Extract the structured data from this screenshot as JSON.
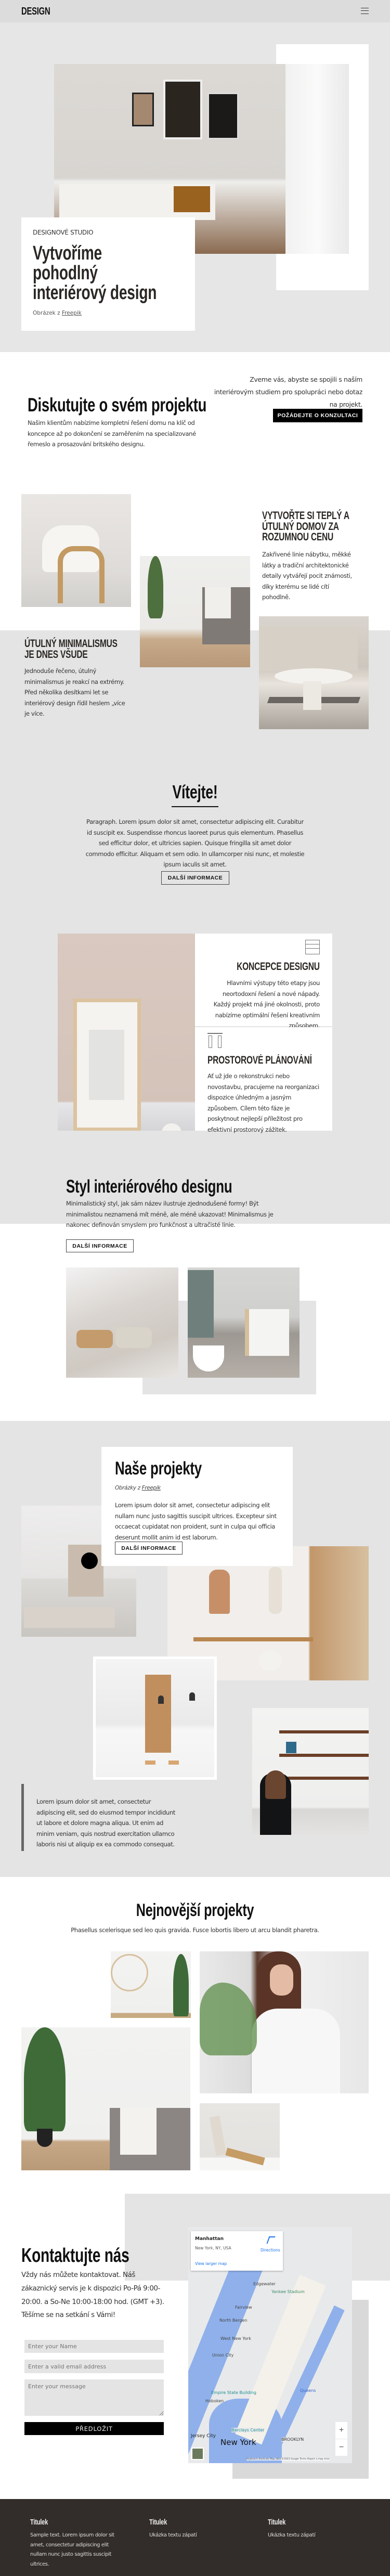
{
  "header": {
    "logo": "DESIGN",
    "menu_icon": "hamburger-icon"
  },
  "hero": {
    "eyebrow": "DESIGNOVÉ STUDIO",
    "title_lines": [
      "Vytvoříme",
      "pohodlný",
      "interiérový design"
    ],
    "credit_prefix": "Obrázek z",
    "credit_link": "Freepik"
  },
  "discuss": {
    "title": "Diskutujte o svém projektu",
    "text": "Našim klientům nabízíme kompletní řešení domu na klíč od koncepce až po dokončení se zaměřením na specializované řemeslo a prosazování britského designu.",
    "invite": "Zveme vás, abyste se spojili s naším interiérovým studiem pro spolupráci nebo dotaz na projekt.",
    "button": "POŽÁDEJTE O KONZULTACI"
  },
  "features": {
    "warm_title": "VYTVOŘTE SI TEPLÝ A ÚTULNÝ DOMOV ZA ROZUMNOU CENU",
    "warm_text": "Zakřivené linie nábytku, měkké látky a tradiční architektonické detaily vytvářejí pocit známosti, díky kterému se lidé cítí pohodlně.",
    "minimal_title": "ÚTULNÝ MINIMALISMUS JE DNES VŠUDE",
    "minimal_text": "Jednoduše řečeno, útulný minimalismus je reakcí na extrémy. Před několika desítkami let se interiérový design řídil heslem „více je více."
  },
  "welcome": {
    "title": "Vítejte!",
    "text": "Paragraph. Lorem ipsum dolor sit amet, consectetur adipiscing elit. Curabitur id suscipit ex. Suspendisse rhoncus laoreet purus quis elementum. Phasellus sed efficitur dolor, et ultricies sapien. Quisque fringilla sit amet dolor commodo efficitur. Aliquam et sem odio. In ullamcorper nisi nunc, et molestie ipsum iaculis sit amet.",
    "button": "DALŠÍ INFORMACE"
  },
  "services": [
    {
      "icon": "drawer-cabinet-icon",
      "title": "KONCEPCE DESIGNU",
      "text": "Hlavními výstupy této etapy jsou neortodoxní řešení a nové nápady. Každý projekt má jiné okolnosti, proto nabízíme optimální řešení kreativním způsobem."
    },
    {
      "icon": "curtains-icon",
      "title": "PROSTOROVÉ PLÁNOVÁNÍ",
      "text": "Ať už jde o rekonstrukci nebo novostavbu, pracujeme na reorganizaci dispozice úhledným a jasným způsobem. Cílem této fáze je poskytnout nejlepší příležitost pro efektivní prostorový zážitek."
    }
  ],
  "style": {
    "title": "Styl interiérového designu",
    "text": "Minimalistický styl, jak sám název ilustruje zjednodušené formy! Být minimalistou neznamená mít méně, ale méně ukazovat! Minimalismus je nakonec definován smyslem pro funkčnost a ultračisté linie.",
    "button": "DALŠÍ INFORMACE"
  },
  "projects": {
    "title": "Naše projekty",
    "credit_prefix": "Obrázky z",
    "credit_link": "Freepik",
    "text": "Lorem ipsum dolor sit amet, consectetur adipiscing elit nullam nunc justo sagittis suscipit ultrices. Excepteur sint occaecat cupidatat non proident, sunt in culpa qui officia deserunt mollit anim id est laborum.",
    "button": "DALŠÍ INFORMACE",
    "quote": "Lorem ipsum dolor sit amet, consectetur adipiscing elit, sed do eiusmod tempor incididunt ut labore et dolore magna aliqua. Ut enim ad minim veniam, quis nostrud exercitation ullamco laboris nisi ut aliquip ex ea commodo consequat."
  },
  "latest": {
    "title": "Nejnovější projekty",
    "subtitle": "Phasellus scelerisque sed leo quis gravida. Fusce lobortis libero ut arcu blandit pharetra."
  },
  "contact": {
    "title": "Kontaktujte nás",
    "text": "Vždy nás můžete kontaktovat. Náš zákaznický servis je k dispozici Po-Pá 9:00-20:00. a So-Ne 10:00-18:00 hod. (GMT +3). Těšíme se na setkání s Vámi!",
    "name_placeholder": "Enter your Name",
    "email_placeholder": "Enter a valid email address",
    "message_placeholder": "Enter your message",
    "submit": "PŘEDLOŽIT"
  },
  "map": {
    "place": "Manhattan",
    "address": "New York, NY, USA",
    "directions": "Directions",
    "larger": "View larger map",
    "city_label": "New York",
    "labels": [
      "Edgewater",
      "Fairview",
      "North Bergen",
      "West New York",
      "Union City",
      "Hoboken",
      "Jersey City",
      "Yankee Stadium",
      "Brooklyn",
      "Queens",
      "Barclays Center",
      "Empire State Building"
    ],
    "zoom_in": "+",
    "zoom_out": "−",
    "attribution": "Keyboard shortcuts  Map data ©2023 Google  Terms  Report a map error"
  },
  "footer": {
    "columns": [
      {
        "title": "Titulek",
        "text": "Sample text. Lorem ipsum dolor sit amet, consectetur adipiscing elit nullam nunc justo sagittis suscipit ultrices."
      },
      {
        "title": "Titulek",
        "text": "Ukázka textu zápatí"
      },
      {
        "title": "Titulek",
        "text": "Ukázka textu zápatí"
      }
    ]
  },
  "colors": {
    "grey": "#e4e4e4",
    "dark": "#322d2a",
    "black": "#000000"
  }
}
